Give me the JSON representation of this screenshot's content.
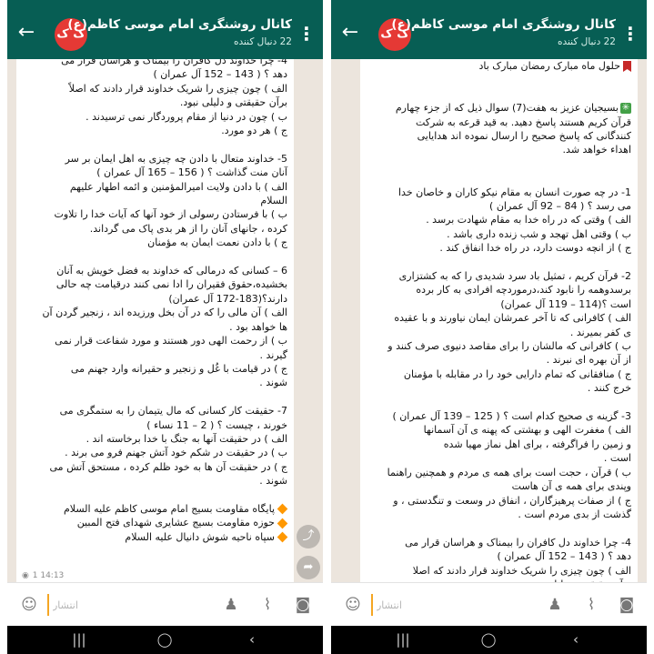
{
  "colors": {
    "header": "#075e54",
    "avatar": "#e53935",
    "chat_bg": "#ece5dd",
    "bubble": "#ffffff",
    "accent_cursor": "#f5a623"
  },
  "icons": {
    "back": "arrow-left-icon",
    "menu": "more-vert-icon",
    "emoji": "smiley-icon",
    "bell": "bell-icon",
    "attach": "paperclip-icon",
    "camera": "camera-icon",
    "share": "share-icon",
    "forward": "forward-icon",
    "views": "eye-icon"
  },
  "header": {
    "back_glyph": "←",
    "avatar_text": "ک ک",
    "title": "کانال روشنگری امام موسی کاظم(ع)",
    "subtitle": "22 دنبال کننده",
    "menu_glyph": "⋮"
  },
  "input": {
    "placeholder": "انتشار"
  },
  "nav": {
    "recents": "|||",
    "home": "◯",
    "back": "‹"
  },
  "left": {
    "views": "1",
    "time": "14:13",
    "lines": [
      "4- چرا خداوند دل کافران را بیمناک و هراسان قرار می",
      "دهد ؟ ( 143 – 152 آل عمران )",
      "الف ) چون چیزی را شریک خداوند قرار دادند که اصلاً",
      "برآن حقیقتی و دلیلی نبود.",
      "ب ) چون در دنیا از مقام پروردگار نمی ترسیدند .",
      "ج ) هر دو مورد.",
      "",
      "5- خداوند متعال با دادن چه چیزی به اهل ایمان بر سر",
      "آنان منت گذاشت ؟ ( 156 – 165 آل عمران )",
      "الف ) با دادن ولایت امیرالمؤمنین و ائمه اطهار علیهم",
      "السلام",
      "ب ) با فرستادن رسولی از خود آنها که آیات خدا را تلاوت",
      "کرده ، جانهای آنان را از هر بدی پاک می گرداند.",
      "ج ) با دادن نعمت ایمان به مؤمنان",
      "",
      "6 – کسانی که درمالی که خداوند به فضل خویش به آنان",
      "بخشیده،حقوق فقیران را ادا نمی کنند درقیامت چه حالی",
      "دارند؟(183-172 آل عمران)",
      "الف ) آن مالی را که در آن بخل ورزیده اند ، زنجیر گردن آن",
      "ها خواهد بود .",
      "ب ) از رحمت الهی دور هستند و مورد شفاعت قرار نمی",
      "گیرند .",
      "ج ) در قیامت با غُل و زنجیر و حقیرانه وارد جهنم می",
      "شوند .",
      "",
      "7- حقیقت کار کسانی که مال یتیمان را به ستمگری می",
      "خورند ، چیست ؟ ( 2 – 11 نساء )",
      "الف ) در حقیقت آنها به جنگ با خدا برخاسته اند .",
      "ب ) در حقیقت در شکم خود آتش جهنم فرو می برند .",
      "ج ) در حقیقت آن ها به خود ظلم کرده ، مستحق آتش می",
      "شوند .",
      ""
    ],
    "footer_lines": [
      "پایگاه مقاومت بسیج امام موسی کاظم علیه السلام",
      "حوزه مقاومت بسیج عشایری شهدای فتح المبین",
      "سپاه ناحیه شوش دانیال علیه السلام"
    ]
  },
  "right": {
    "lines": [
      "حلول ماه مبارک رمضان مبارک باد",
      "",
      "",
      "بسیجیان عزیز به هفت(7) سوال ذیل که از جزء چهارم",
      "قرآن کریم هستند پاسخ دهید. به قید قرعه به شرکت",
      "کنندگانی که پاسخ صحیح را ارسال نموده اند هدایایی",
      "اهداء خواهد شد.",
      "",
      "",
      "1- در چه صورت انسان به مقام نیکو کاران و خاصان خدا",
      "می رسد ؟ ( 84 – 92 آل عمران )",
      "الف ) وقتی که در راه خدا به مقام شهادت برسد .",
      "ب ) وقتی اهل تهجد و شب زنده داری باشد .",
      "ج ) از انچه دوست دارد، در راه خدا انفاق کند .",
      "",
      "2- قرآن کریم ، تمثیل باد سرد شدیدی را که به کشتزاری",
      "برسدوهمه را نابود کند،درموردچه افرادی به کار برده",
      "است ؟(114 – 119 آل عمران)",
      "الف ) کافرانی که تا آخر عمرشان ایمان نیاورند و با عقیده",
      "ی کفر بمیرند .",
      "ب ) کافرانی که مالشان را برای مقاصد دنیوی صرف کنند و",
      "از آن بهره ای نبرند .",
      "ج ) منافقانی که تمام دارایی خود را در مقابله با مؤمنان",
      "خرج کنند .",
      "",
      "3- گزینه ی صحیح کدام است ؟ ( 125 – 139 آل عمران )",
      "الف ) مغفرت الهی و بهشتی که پهنه ی آن آسمانها",
      "و زمین را فراگرفته ، برای اهل نماز مهیا شده",
      "است .",
      "ب ) قرآن ، حجت است برای همه ی مردم و همچنین راهنما",
      "وپندی برای همه ی آن هاست",
      "ج ) از صفات پرهیزگاران ، انفاق در وسعت و تنگدستی ، و",
      "گذشت از بدی مردم است .",
      "",
      "4- چرا خداوند دل کافران را بیمناک و هراسان قرار می",
      "دهد ؟ ( 143 – 152 آل عمران )",
      "الف ) چون چیزی را شریک خداوند قرار دادند که اصلا",
      "برآن حقیقتی و دلیلی نبود."
    ]
  }
}
